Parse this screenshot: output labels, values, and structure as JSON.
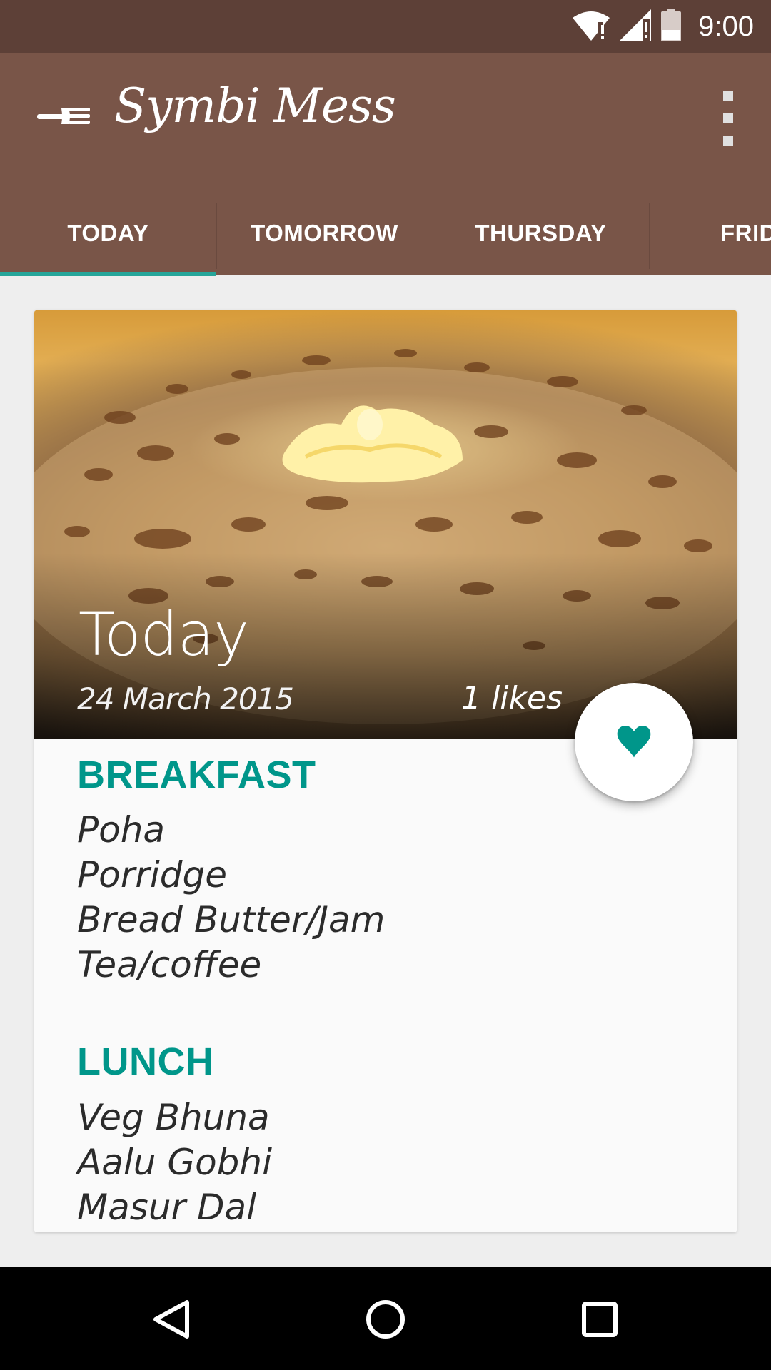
{
  "status_bar": {
    "time": "9:00",
    "icons": [
      "wifi-alert-icon",
      "signal-alert-icon",
      "battery-icon"
    ]
  },
  "app_bar": {
    "title": "Symbi Mess",
    "logo_icon": "fork-icon",
    "menu_icon": "more-vert-icon"
  },
  "tabs": {
    "items": [
      {
        "label": "TODAY",
        "selected": true
      },
      {
        "label": "TOMORROW",
        "selected": false
      },
      {
        "label": "THURSDAY",
        "selected": false
      },
      {
        "label": "FRID",
        "selected": false
      }
    ]
  },
  "card": {
    "title": "Today",
    "date": "24 March 2015",
    "likes": "1 likes",
    "sections": [
      {
        "title": "BREAKFAST",
        "items": [
          "Poha",
          "Porridge",
          "Bread Butter/Jam",
          "Tea/coffee"
        ]
      },
      {
        "title": "LUNCH",
        "items": [
          "Veg Bhuna",
          "Aalu Gobhi",
          "Masur Dal"
        ]
      }
    ]
  },
  "fab": {
    "icon": "heart-icon"
  },
  "nav": {
    "buttons": [
      "back-icon",
      "home-icon",
      "recents-icon"
    ]
  },
  "colors": {
    "status_bar": "#5d4037",
    "primary": "#795548",
    "accent": "#009688",
    "background": "#eeeeee",
    "card": "#fafafa"
  }
}
